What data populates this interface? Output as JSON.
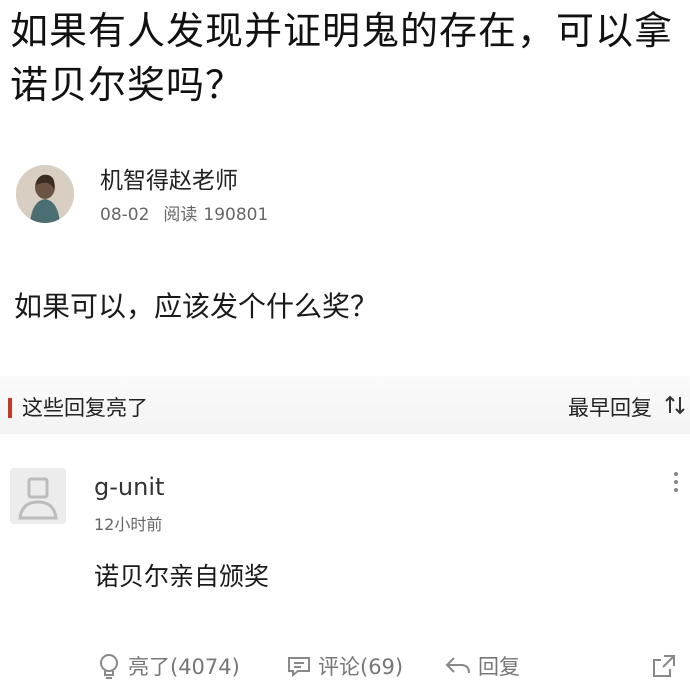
{
  "question": {
    "title": "如果有人发现并证明鬼的存在，可以拿诺贝尔奖吗？",
    "body": "如果可以，应该发个什么奖？"
  },
  "author": {
    "name": "机智得赵老师",
    "date": "08-02",
    "views_label": "阅读",
    "views": "190801"
  },
  "replies_header": {
    "label": "这些回复亮了",
    "sort_label": "最早回复",
    "sort_icon": "sort-arrows-icon"
  },
  "comment": {
    "username": "g-unit",
    "time": "12小时前",
    "text": "诺贝尔亲自颁奖",
    "more_icon": "more-vertical-icon"
  },
  "actions": {
    "like_label": "亮了(4074)",
    "comment_label": "评论(69)",
    "reply_label": "回复",
    "share_icon": "share-icon"
  },
  "colors": {
    "accent": "#c0392b",
    "muted": "#777777"
  }
}
